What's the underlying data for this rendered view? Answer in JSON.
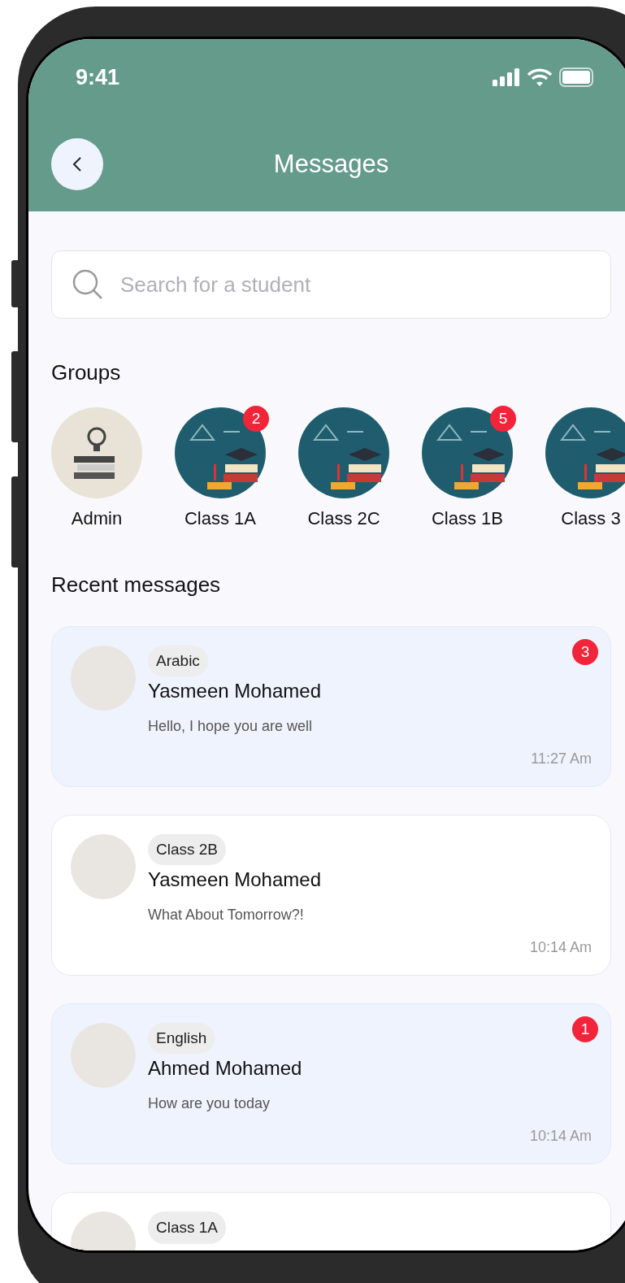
{
  "status_bar": {
    "time": "9:41"
  },
  "header": {
    "title": "Messages"
  },
  "search": {
    "placeholder": "Search for a student"
  },
  "groups": {
    "title": "Groups",
    "items": [
      {
        "label": "Admin",
        "kind": "admin"
      },
      {
        "label": "Class 1A",
        "kind": "class",
        "badge": "2"
      },
      {
        "label": "Class 2C",
        "kind": "class"
      },
      {
        "label": "Class 1B",
        "kind": "class",
        "badge": "5"
      },
      {
        "label": "Class 3",
        "kind": "class"
      }
    ]
  },
  "recent": {
    "title": "Recent messages",
    "items": [
      {
        "tag": "Arabic",
        "name": "Yasmeen Mohamed",
        "preview": "Hello, I hope you are well",
        "time": "11:27 Am",
        "unread": true,
        "badge": "3"
      },
      {
        "tag": "Class 2B",
        "name": "Yasmeen Mohamed",
        "preview": "What About Tomorrow?!",
        "time": "10:14 Am",
        "unread": false
      },
      {
        "tag": "English",
        "name": "Ahmed Mohamed",
        "preview": "How are you today",
        "time": "10:14 Am",
        "unread": true,
        "badge": "1"
      },
      {
        "tag": "Class 1A",
        "unread": false
      }
    ]
  }
}
